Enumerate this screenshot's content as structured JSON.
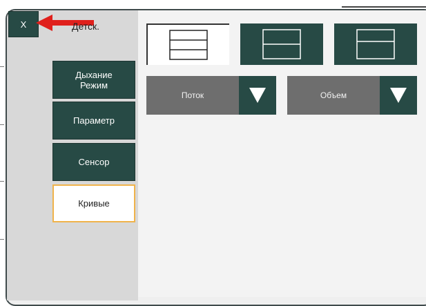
{
  "close_button": {
    "label": "X"
  },
  "mode_label": "Детск.",
  "side_menu": [
    {
      "label": "Дыхание Режим",
      "active": false
    },
    {
      "label": "Параметр",
      "active": false
    },
    {
      "label": "Сенсор",
      "active": false
    },
    {
      "label": "Кривые",
      "active": true
    }
  ],
  "layout_options": [
    {
      "icon": "three-rows-layout-icon",
      "selected": true
    },
    {
      "icon": "two-rows-layout-icon",
      "selected": false
    },
    {
      "icon": "two-rows-layout-icon",
      "selected": false
    }
  ],
  "dropdowns": [
    {
      "value": "Поток"
    },
    {
      "value": "Объем"
    }
  ],
  "colors": {
    "button_dark": "#274a45",
    "dropdown_gray": "#6e6e6e",
    "active_border": "#f0b34a",
    "pointer_arrow": "#e0201c"
  }
}
